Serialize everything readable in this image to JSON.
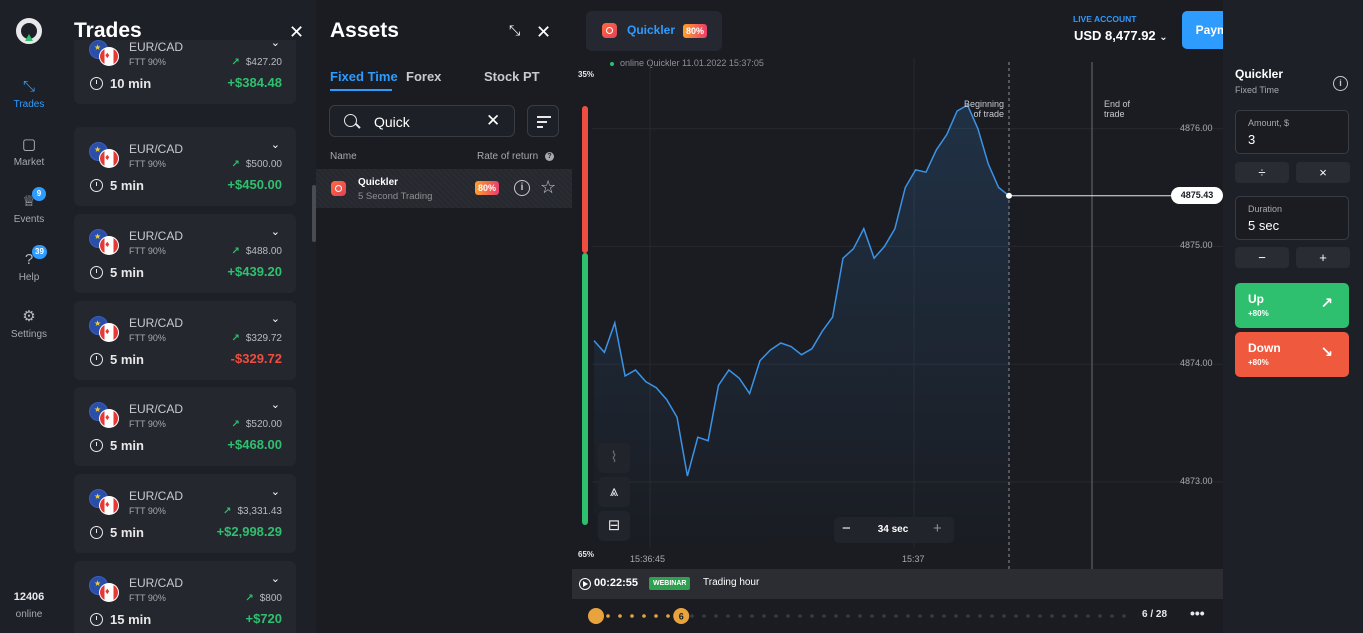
{
  "nav": {
    "items": [
      {
        "label": "Trades",
        "icon": "trades-arrows-icon",
        "active": true
      },
      {
        "label": "Market",
        "icon": "market-bag-icon"
      },
      {
        "label": "Events",
        "icon": "trophy-icon",
        "badge": "9"
      },
      {
        "label": "Help",
        "icon": "help-question-icon",
        "badge": "39"
      },
      {
        "label": "Settings",
        "icon": "gear-icon"
      }
    ],
    "online_count": "12406",
    "online_label": "online"
  },
  "trades_panel": {
    "title": "Trades",
    "trades": [
      {
        "pair": "EUR/CAD",
        "ftt": "FTT 90%",
        "investment": "$427.20",
        "duration": "10 min",
        "profit": "+$384.48",
        "result": "win"
      },
      {
        "pair": "EUR/CAD",
        "ftt": "FTT 90%",
        "investment": "$500.00",
        "duration": "5 min",
        "profit": "+$450.00",
        "result": "win"
      },
      {
        "pair": "EUR/CAD",
        "ftt": "FTT 90%",
        "investment": "$488.00",
        "duration": "5 min",
        "profit": "+$439.20",
        "result": "win"
      },
      {
        "pair": "EUR/CAD",
        "ftt": "FTT 90%",
        "investment": "$329.72",
        "duration": "5 min",
        "profit": "-$329.72",
        "result": "loss"
      },
      {
        "pair": "EUR/CAD",
        "ftt": "FTT 90%",
        "investment": "$520.00",
        "duration": "5 min",
        "profit": "+$468.00",
        "result": "win"
      },
      {
        "pair": "EUR/CAD",
        "ftt": "FTT 90%",
        "investment": "$3,331.43",
        "duration": "5 min",
        "profit": "+$2,998.29",
        "result": "win"
      },
      {
        "pair": "EUR/CAD",
        "ftt": "FTT 90%",
        "investment": "$800",
        "duration": "15 min",
        "profit": "+$720",
        "result": "win"
      }
    ]
  },
  "assets_panel": {
    "title": "Assets",
    "tabs": [
      {
        "label": "Fixed Time",
        "active": true
      },
      {
        "label": "Forex"
      },
      {
        "label": "Stock PT"
      }
    ],
    "search": {
      "value": "Quick"
    },
    "columns": {
      "name": "Name",
      "rate": "Rate of return"
    },
    "assets": [
      {
        "name": "Quickler",
        "subtitle": "5 Second Trading",
        "rate": "80%"
      }
    ]
  },
  "chart_header": {
    "asset_name": "Quickler",
    "rate": "80%",
    "online_info": "online Quickler  11.01.2022 15:37:05"
  },
  "chart": {
    "sentiment_top": "35%",
    "sentiment_bottom": "65%",
    "begin_label": [
      "Beginning",
      "of trade"
    ],
    "end_label": [
      "End of",
      "trade"
    ],
    "current_price": "4875.43",
    "timeframe": "34 sec",
    "time_labels": [
      "15:36:45",
      "15:37"
    ]
  },
  "chart_data": {
    "type": "line",
    "y_ticks": [
      "4876.00",
      "4875.00",
      "4874.00",
      "4873.00"
    ],
    "ylim": [
      4872.6,
      4876.6
    ],
    "x": [
      0,
      1,
      2,
      3,
      4,
      5,
      6,
      7,
      8,
      9,
      10,
      11,
      12,
      13,
      14,
      15,
      16,
      17,
      18,
      19,
      20,
      21,
      22,
      23,
      24,
      25,
      26,
      27,
      28,
      29,
      30,
      31,
      32,
      33,
      34,
      35,
      36,
      37,
      38,
      39,
      40
    ],
    "values": [
      4874.2,
      4874.1,
      4874.35,
      4873.9,
      4873.95,
      4873.85,
      4873.8,
      4873.7,
      4873.55,
      4873.05,
      4873.38,
      4873.35,
      4873.82,
      4873.95,
      4873.88,
      4873.75,
      4874.03,
      4874.12,
      4874.18,
      4874.15,
      4874.08,
      4874.13,
      4874.28,
      4874.4,
      4874.9,
      4874.98,
      4875.15,
      4874.9,
      4875.0,
      4875.15,
      4875.5,
      4875.65,
      4875.63,
      4875.82,
      4875.95,
      4876.15,
      4876.2,
      4876.0,
      4875.7,
      4875.5,
      4875.43
    ],
    "trade_begin_x": 40,
    "trade_end_x": 48
  },
  "bottom_bar": {
    "timer": "00:22:55",
    "webinar_label": "WEBINAR",
    "trading_hour": "Trading hour",
    "progress_level": "6",
    "progress_count": "6 / 28",
    "progress_fraction": 0.214
  },
  "header": {
    "account_type": "LIVE ACCOUNT",
    "balance": "USD 8,477.92",
    "payments_label": "Payments",
    "level": "6",
    "alert": "!"
  },
  "trade_panel": {
    "asset_name": "Quickler",
    "asset_type": "Fixed Time",
    "amount_label": "Amount, $",
    "amount_value": "3",
    "divide_label": "÷",
    "multiply_label": "×",
    "duration_label": "Duration",
    "duration_value": "5 sec",
    "minus_label": "−",
    "plus_label": "+",
    "up_label": "Up",
    "up_pct": "+80%",
    "down_label": "Down",
    "down_pct": "+80%"
  },
  "colors": {
    "accent": "#2e9bff",
    "up": "#2ec06e",
    "down": "#ef5a3f",
    "line": "#3b93e6"
  }
}
